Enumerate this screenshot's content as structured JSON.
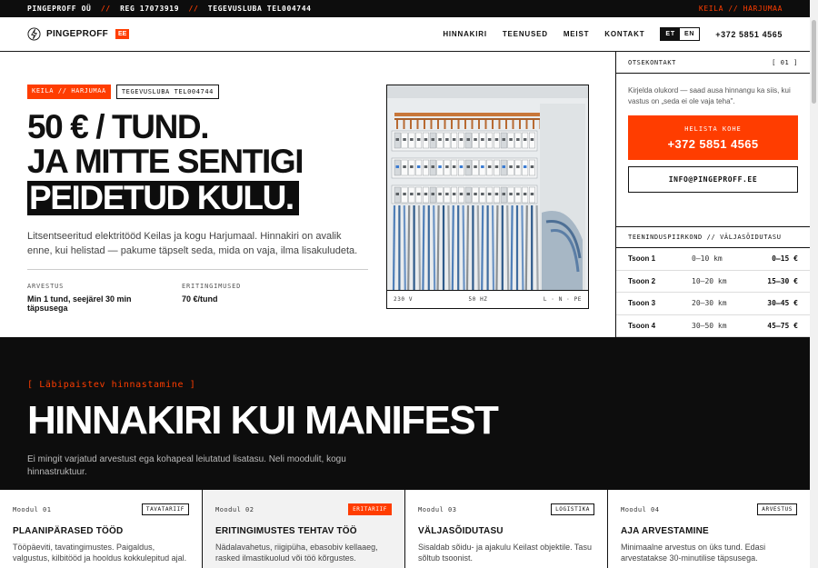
{
  "topbar": {
    "company": "PINGEPROFF OÜ",
    "sep": "//",
    "reg": "REG 17073919",
    "license": "TEGEVUSLUBA TEL004744",
    "location": "KEILA // HARJUMAA"
  },
  "header": {
    "logo_text": "PINGEPROFF",
    "logo_badge": "EE",
    "nav": [
      "HINNAKIRI",
      "TEENUSED",
      "MEIST",
      "KONTAKT"
    ],
    "lang_active": "ET",
    "lang_other": "EN",
    "phone": "+372 5851 4565"
  },
  "hero": {
    "tag_location": "KEILA // HARJUMAA",
    "tag_license": "TEGEVUSLUBA TEL004744",
    "headline_1": "50 € / TUND.",
    "headline_2": "JA MITTE SENTIGI",
    "headline_3": "PEIDETUD KULU.",
    "lead": "Litsentseeritud elektritööd Keilas ja kogu Harjumaal. Hinnakiri on avalik enne, kui helistad — pakume täpselt seda, mida on vaja, ilma lisakuludeta.",
    "facts": [
      {
        "label": "ARVESTUS",
        "value": "Min 1 tund, seejärel 30 min täpsusega"
      },
      {
        "label": "ERITINGIMUSED",
        "value": "70 €/tund"
      }
    ]
  },
  "panel": {
    "specs": [
      "230 V",
      "50 HZ",
      "L · N · PE"
    ]
  },
  "sidebar": {
    "contact_title": "OTSEKONTAKT",
    "contact_index": "[ 01 ]",
    "contact_text": "Kirjelda olukord — saad ausa hinnangu ka siis, kui vastus on „seda ei ole vaja teha\".",
    "call_label": "HELISTA KOHE",
    "call_number": "+372 5851 4565",
    "email": "INFO@PINGEPROFF.EE",
    "zones_title": "TEENINDUSPIIRKOND // VÄLJASÕIDUTASU",
    "zones": [
      {
        "name": "Tsoon 1",
        "dist": "0–10 km",
        "price": "0–15 €"
      },
      {
        "name": "Tsoon 2",
        "dist": "10–20 km",
        "price": "15–30 €"
      },
      {
        "name": "Tsoon 3",
        "dist": "20–30 km",
        "price": "30–45 €"
      },
      {
        "name": "Tsoon 4",
        "dist": "30–50 km",
        "price": "45–75 €"
      }
    ]
  },
  "manifest": {
    "kicker": "[ Läbipaistev hinnastamine ]",
    "title": "HINNAKIRI KUI MANIFEST",
    "subtitle": "Ei mingit varjatud arvestust ega kohapeal leiutatud lisatasu. Neli moodulit, kogu hinnastruktuur."
  },
  "modules": [
    {
      "num": "Moodul 01",
      "badge": "TAVATARIIF",
      "title": "PLAANIPÄRASED TÖÖD",
      "desc": "Tööpäeviti, tavatingimustes. Paigaldus, valgustus, kilbitööd ja hooldus kokkulepitud ajal."
    },
    {
      "num": "Moodul 02",
      "badge": "ERITARIIF",
      "title": "ERITINGIMUSTES TEHTAV TÖÖ",
      "desc": "Nädalavahetus, riigipüha, ebasobiv kellaaeg, rasked ilmastikuolud või töö kõrgustes."
    },
    {
      "num": "Moodul 03",
      "badge": "LOGISTIKA",
      "title": "VÄLJASÕIDUTASU",
      "desc": "Sisaldab sõidu- ja ajakulu Keilast objektile. Tasu sõltub tsoonist."
    },
    {
      "num": "Moodul 04",
      "badge": "ARVESTUS",
      "title": "AJA ARVESTAMINE",
      "desc": "Minimaalne arvestus on üks tund. Edasi arvestatakse 30-minutilise täpsusega."
    }
  ],
  "colors": {
    "accent": "#ff3d00",
    "dark": "#0d0d0d"
  }
}
